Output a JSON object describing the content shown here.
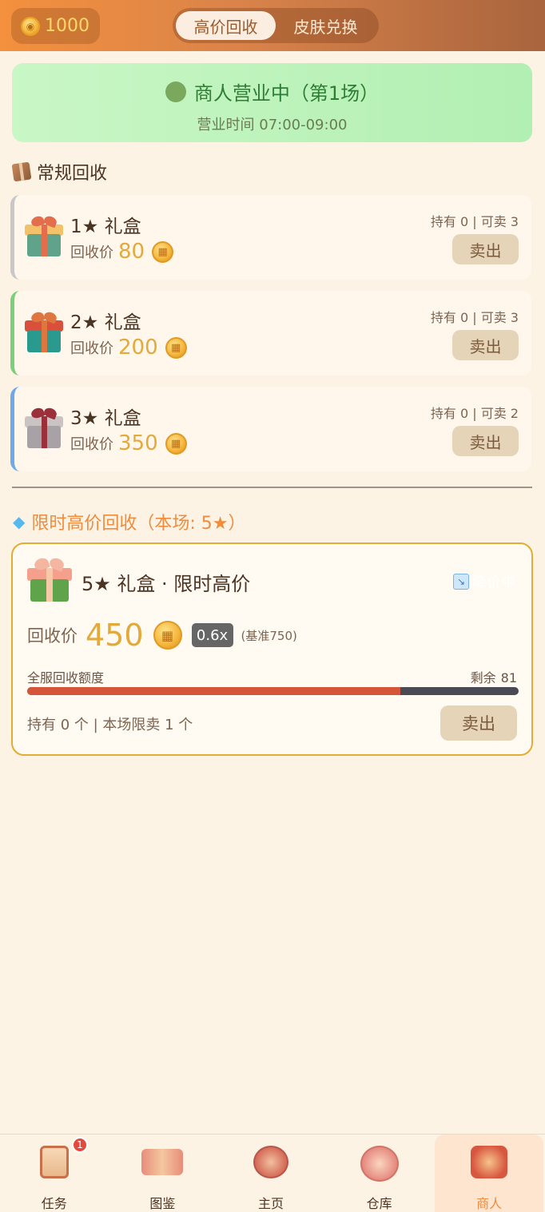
{
  "header": {
    "coin_symbol": "🪙",
    "coin_count": "1000",
    "tabs": [
      {
        "label": "高价回收",
        "active": true
      },
      {
        "label": "皮肤兑换",
        "active": false
      }
    ]
  },
  "status": {
    "title": "商人营业中（第1场）",
    "hours": "营业时间 07:00-09:00"
  },
  "regular": {
    "title": "常规回收",
    "price_label": "回收价",
    "sell_label": "卖出",
    "items": [
      {
        "name": "1★ 礼盒",
        "price": "80",
        "hold": "持有 0 | 可卖 3",
        "accent": "#c8c8c8"
      },
      {
        "name": "2★ 礼盒",
        "price": "200",
        "hold": "持有 0 | 可卖 3",
        "accent": "#7ccf7b"
      },
      {
        "name": "3★ 礼盒",
        "price": "350",
        "hold": "持有 0 | 可卖 2",
        "accent": "#6fa9ec"
      }
    ]
  },
  "limited": {
    "title": "限时高价回收（本场: 5★）",
    "item_name": "5★ 礼盒 · 限时高价",
    "trend": "降价中",
    "price_label": "回收价",
    "price": "450",
    "multiplier": "0.6x",
    "base": "(基准750)",
    "quota_label": "全服回收额度",
    "remain_label": "剩余",
    "remain_value": "81",
    "quota_fill_fraction": 0.76,
    "hold_text": "持有 0 个 | 本场限卖 1 个",
    "sell_label": "卖出"
  },
  "nav": {
    "items": [
      {
        "label": "任务",
        "badge": "1",
        "icon": "task-scroll-icon"
      },
      {
        "label": "图鉴",
        "icon": "book-icon"
      },
      {
        "label": "主页",
        "icon": "home-icon"
      },
      {
        "label": "仓库",
        "icon": "warehouse-icon"
      },
      {
        "label": "商人",
        "icon": "merchant-icon",
        "active": true
      }
    ]
  },
  "colors": {
    "accent_orange": "#ef8c3e",
    "gold": "#e3a93a",
    "status_green": "#2f7d35"
  }
}
